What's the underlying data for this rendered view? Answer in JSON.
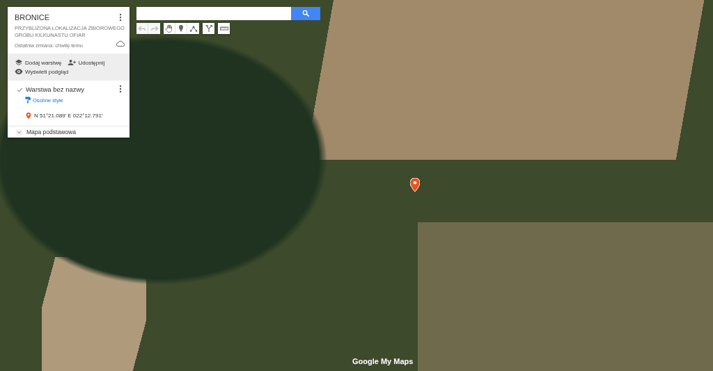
{
  "map": {
    "title": "BRONICE",
    "description": "PRZYBLIŻONA LOKALIZACJA ZBIOROWEGO GROBU KILKUNASTU OFIAR",
    "last_change": "Ostatnia zmiana: chwilę temu"
  },
  "actions": [
    {
      "kind": "layer",
      "label": "Dodaj warstwę"
    },
    {
      "kind": "share",
      "label": "Udostępnij"
    },
    {
      "kind": "preview",
      "label": "Wyświetl podgląd"
    }
  ],
  "layers": [
    {
      "name": "Warstwa bez nazwy",
      "checked": true,
      "style_link": "Osobne style",
      "places": [
        {
          "label": "N 51°21.089′ E 022°12.791′"
        }
      ]
    }
  ],
  "base_map": {
    "label": "Mapa podstawowa",
    "expanded": false
  },
  "tools": [
    {
      "kind": "undo",
      "disabled": true
    },
    {
      "kind": "redo",
      "disabled": true
    },
    {
      "kind": "hand",
      "disabled": false
    },
    {
      "kind": "marker",
      "disabled": false
    },
    {
      "kind": "line",
      "disabled": false
    },
    {
      "kind": "route",
      "disabled": false
    },
    {
      "kind": "ruler",
      "disabled": false
    }
  ],
  "logo": "Google My Maps"
}
